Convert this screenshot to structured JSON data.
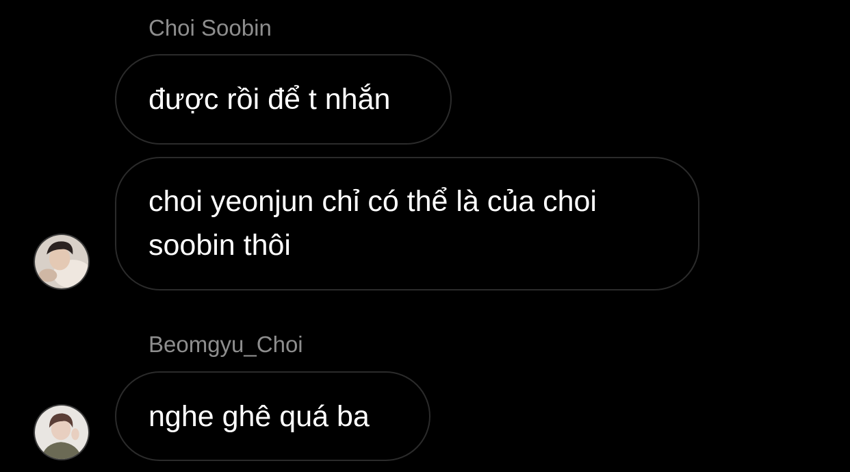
{
  "messages": [
    {
      "sender": "Choi Soobin",
      "text": "được rồi để t nhắn"
    },
    {
      "sender": "",
      "text": "choi yeonjun chỉ có thể là của choi soobin thôi"
    },
    {
      "sender": "Beomgyu_Choi",
      "text": "nghe ghê quá ba"
    }
  ],
  "avatars": [
    {
      "icon": "user-avatar-icon",
      "of": "Choi Soobin"
    },
    {
      "icon": "user-avatar-icon",
      "of": "Beomgyu_Choi"
    }
  ],
  "colors": {
    "background": "#000000",
    "bubble_border": "#2b2b2b",
    "bubble_text": "#ffffff",
    "sender_name": "#8e8e8e"
  }
}
